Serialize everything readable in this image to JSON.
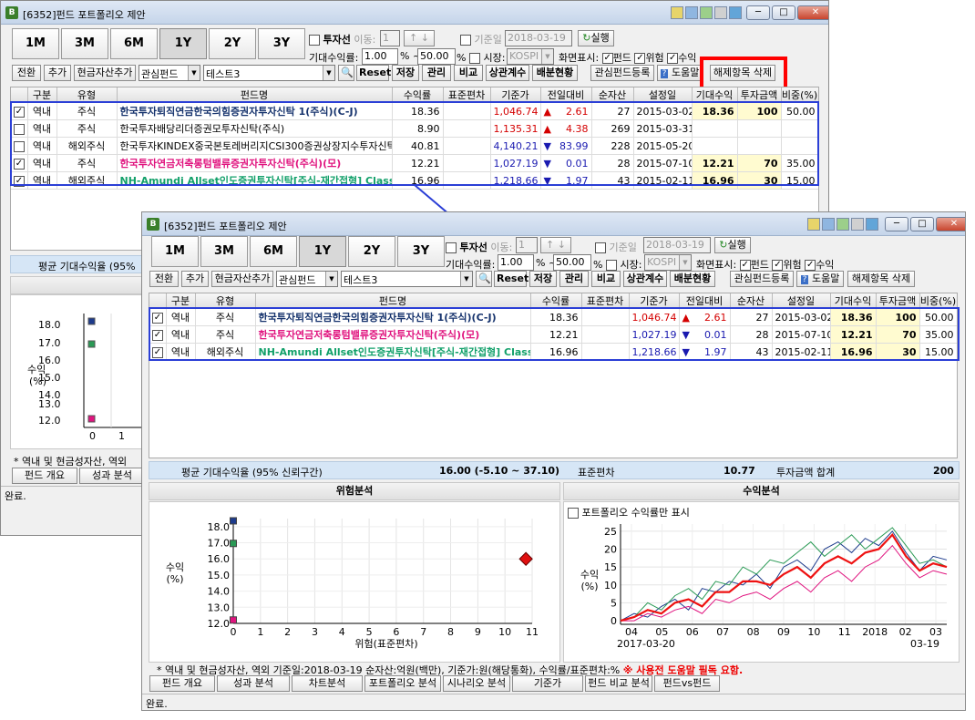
{
  "window": {
    "title": "[6352]펀드 포트폴리오 제안"
  },
  "periods": [
    "1M",
    "3M",
    "6M",
    "1Y",
    "2Y",
    "3Y"
  ],
  "controls": {
    "investor_label": "투자선",
    "move_label": "이동:",
    "move_value": "1",
    "ref_date_label": "기준일",
    "ref_date": "2018-03-19",
    "execute": "실행",
    "expected_return_label": "기대수익률:",
    "ret_from": "1.00",
    "ret_to": "50.00",
    "pct": "%",
    "tilde": "~",
    "market_label": "시장:",
    "market_value": "KOSPI",
    "display_label": "화면표시:",
    "show_fund": "펀드",
    "show_risk": "위험",
    "show_return": "수익",
    "switch": "전환",
    "add": "추가",
    "add_cash": "현금자산추가",
    "interest_fund": "관심펀드",
    "fund_input": "테스트3",
    "reset": "Reset",
    "save": "저장",
    "manage": "관리",
    "compare": "비교",
    "correlation": "상관계수",
    "distribution": "배분현황",
    "register_interest": "관심펀드등록",
    "help": "도움말",
    "delete_item": "해제항목 삭제"
  },
  "columns": [
    "구분",
    "유형",
    "펀드명",
    "수익률",
    "표준편차",
    "기준가",
    "전일대비",
    "순자산",
    "설정일",
    "기대수익",
    "투자금액",
    "비중(%)"
  ],
  "rows_w1": [
    {
      "checked": true,
      "region": "역내",
      "type": "주식",
      "name": "한국투자퇴직연금한국의힘증권자투자신탁 1(주식)(C-J)",
      "ret": "18.36",
      "std": "",
      "price": "1,046.74",
      "dir": "▲",
      "chg": "2.61",
      "nav": "27",
      "date": "2015-03-02",
      "exp": "18.36",
      "amt": "100",
      "w": "50.00",
      "cls": "n1",
      "pc": "up"
    },
    {
      "checked": false,
      "region": "역내",
      "type": "주식",
      "name": "한국투자배당리더증권모투자신탁(주식)",
      "ret": "8.90",
      "std": "",
      "price": "1,135.31",
      "dir": "▲",
      "chg": "4.38",
      "nav": "269",
      "date": "2015-03-31",
      "exp": "",
      "amt": "",
      "w": "",
      "cls": "",
      "pc": "up"
    },
    {
      "checked": false,
      "region": "역내",
      "type": "해외주식",
      "name": "한국투자KINDEX중국본토레버리지CSI300증권상장지수투자신탁(주",
      "ret": "40.81",
      "std": "",
      "price": "4,140.21",
      "dir": "▼",
      "chg": "83.99",
      "nav": "228",
      "date": "2015-05-20",
      "exp": "",
      "amt": "",
      "w": "",
      "cls": "",
      "pc": "dn"
    },
    {
      "checked": true,
      "region": "역내",
      "type": "주식",
      "name": "한국투자연금저축롱텀밸류증권자투자신탁(주식)(모)",
      "ret": "12.21",
      "std": "",
      "price": "1,027.19",
      "dir": "▼",
      "chg": "0.01",
      "nav": "28",
      "date": "2015-07-10",
      "exp": "12.21",
      "amt": "70",
      "w": "35.00",
      "cls": "n3",
      "pc": "dn"
    },
    {
      "checked": true,
      "region": "역내",
      "type": "해외주식",
      "name": "NH-Amundi Allset인도증권투자신탁[주식-재간접형] Class",
      "ret": "16.96",
      "std": "",
      "price": "1,218.66",
      "dir": "▼",
      "chg": "1.97",
      "nav": "43",
      "date": "2015-02-11",
      "exp": "16.96",
      "amt": "30",
      "w": "15.00",
      "cls": "n4",
      "pc": "dn"
    }
  ],
  "rows_w2": [
    {
      "checked": true,
      "region": "역내",
      "type": "주식",
      "name": "한국투자퇴직연금한국의힘증권자투자신탁 1(주식)(C-J)",
      "ret": "18.36",
      "std": "",
      "price": "1,046.74",
      "dir": "▲",
      "chg": "2.61",
      "nav": "27",
      "date": "2015-03-02",
      "exp": "18.36",
      "amt": "100",
      "w": "50.00",
      "cls": "n1",
      "pc": "up"
    },
    {
      "checked": true,
      "region": "역내",
      "type": "주식",
      "name": "한국투자연금저축롱텀밸류증권자투자신탁(주식)(모)",
      "ret": "12.21",
      "std": "",
      "price": "1,027.19",
      "dir": "▼",
      "chg": "0.01",
      "nav": "28",
      "date": "2015-07-10",
      "exp": "12.21",
      "amt": "70",
      "w": "35.00",
      "cls": "n3",
      "pc": "dn"
    },
    {
      "checked": true,
      "region": "역내",
      "type": "해외주식",
      "name": "NH-Amundi Allset인도증권투자신탁[주식-재간접형] Class",
      "ret": "16.96",
      "std": "",
      "price": "1,218.66",
      "dir": "▼",
      "chg": "1.97",
      "nav": "43",
      "date": "2015-02-11",
      "exp": "16.96",
      "amt": "30",
      "w": "15.00",
      "cls": "n4",
      "pc": "dn"
    }
  ],
  "summary": {
    "avg_label": "평균 기대수익율 (95% 신뢰구간)",
    "avg_value": "16.00 (-5.10 ~ 37.10)",
    "std_label": "표준편차",
    "std_value": "10.77",
    "total_label": "투자금액 합계",
    "total_value": "200",
    "avg_short": "평균 기대수익율 (95%"
  },
  "risk_panel": {
    "title": "위험분석",
    "ylabel": "수익\n(%)",
    "xlabel": "위험(표준편차)"
  },
  "return_panel": {
    "title": "수익분석",
    "only_portfolio": "포트폴리오 수익률만 표시",
    "ylabel": "수익\n(%)",
    "start": "2017-03-20",
    "end": "03-19"
  },
  "chart_data": [
    {
      "type": "scatter",
      "title": "위험분석",
      "xlabel": "위험(표준편차)",
      "ylabel": "수익 (%)",
      "xlim": [
        0,
        11
      ],
      "ylim": [
        12,
        18.5
      ],
      "x_ticks": [
        0,
        1,
        2,
        3,
        4,
        5,
        6,
        7,
        8,
        9,
        10,
        11
      ],
      "y_ticks": [
        12.0,
        13.0,
        14.0,
        15.0,
        16.0,
        17.0,
        18.0
      ],
      "series": [
        {
          "color": "#1d3b8c",
          "marker": "square",
          "points": [
            [
              0,
              18.36
            ]
          ]
        },
        {
          "color": "#2a9a55",
          "marker": "square",
          "points": [
            [
              0,
              16.96
            ]
          ]
        },
        {
          "color": "#e0147f",
          "marker": "square",
          "points": [
            [
              0,
              12.21
            ]
          ]
        },
        {
          "color": "#e01010",
          "marker": "diamond",
          "points": [
            [
              10.77,
              16.0
            ]
          ]
        }
      ]
    },
    {
      "type": "line",
      "title": "수익분석",
      "ylabel": "수익 (%)",
      "ylim": [
        -1,
        27
      ],
      "y_ticks": [
        0,
        5,
        10,
        15,
        20,
        25
      ],
      "x_tick_labels": [
        "04",
        "05",
        "06",
        "07",
        "08",
        "09",
        "10",
        "11",
        "2018",
        "02",
        "03"
      ],
      "x": [
        0,
        1,
        2,
        3,
        4,
        5,
        6,
        7,
        8,
        9,
        10,
        11,
        12,
        13,
        14,
        15,
        16,
        17,
        18,
        19,
        20,
        21,
        22,
        23,
        24
      ],
      "series": [
        {
          "color": "#1d3b8c",
          "values": [
            0,
            2,
            1,
            4,
            6,
            3,
            9,
            8,
            11,
            10,
            13,
            9,
            15,
            17,
            14,
            20,
            22,
            19,
            23,
            21,
            25,
            19,
            14,
            18,
            17
          ]
        },
        {
          "color": "#2a9a55",
          "values": [
            0,
            1,
            5,
            3,
            7,
            9,
            6,
            11,
            10,
            15,
            13,
            17,
            16,
            19,
            22,
            18,
            21,
            24,
            20,
            23,
            26,
            21,
            16,
            17,
            15
          ]
        },
        {
          "color": "#e0147f",
          "values": [
            0,
            0,
            2,
            1,
            3,
            4,
            2,
            6,
            5,
            7,
            8,
            6,
            9,
            11,
            8,
            12,
            14,
            11,
            15,
            17,
            21,
            16,
            12,
            14,
            13
          ]
        },
        {
          "color": "#ee1111",
          "values": [
            0,
            1,
            3,
            2,
            5,
            6,
            4,
            8,
            8,
            11,
            11,
            10,
            13,
            15,
            12,
            16,
            18,
            16,
            19,
            20,
            24,
            18,
            14,
            16,
            15
          ]
        }
      ]
    }
  ],
  "footer": {
    "note": "* 역내 및 현금성자산, 역외 기준일:2018-03-19  순자산:억원(백만), 기준가:원(해당통화), 수익률/표준편차:%",
    "warn": "※ 사용전 도움말 필독 요함.",
    "note_short": "* 역내 및 현금성자산, 역외",
    "tabs": [
      "펀드 개요",
      "성과 분석",
      "차트분석",
      "포트폴리오 분석",
      "시나리오 분석",
      "기준가",
      "펀드 비교 분석",
      "펀드vs펀드"
    ],
    "status": "완료."
  },
  "colors": {
    "highlight_red": "#ff0000",
    "highlight_blue": "#2b3fd6",
    "arrow": "#2b3fd6"
  }
}
